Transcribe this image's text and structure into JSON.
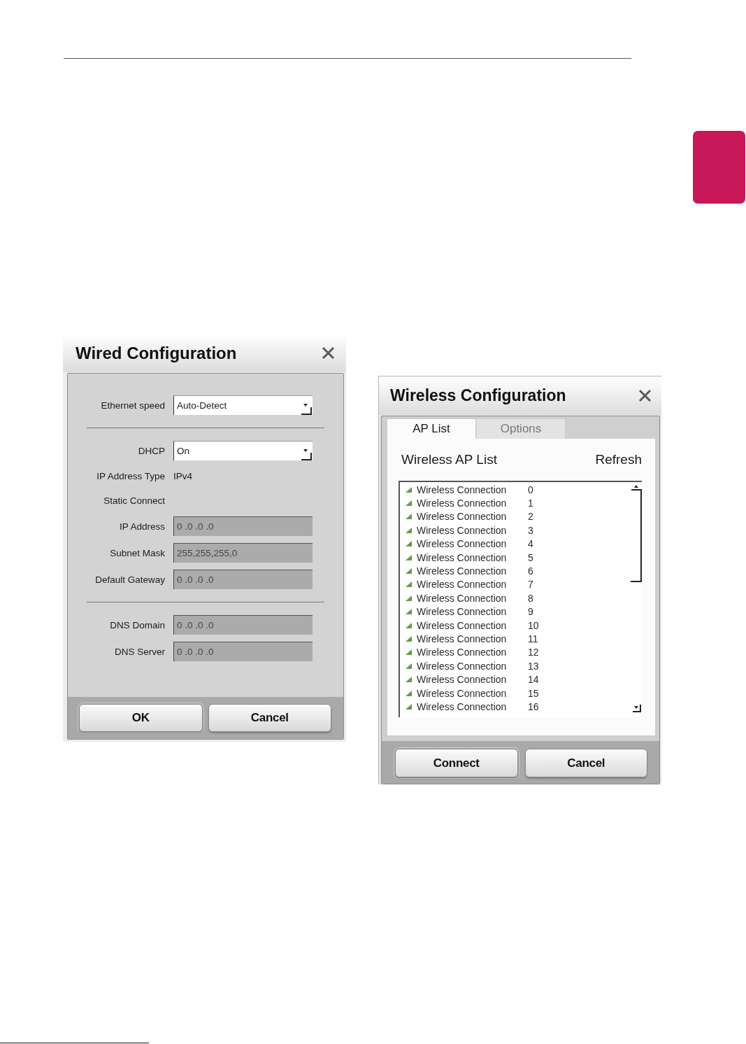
{
  "wired_dialog": {
    "title": "Wired Configuration",
    "sections": [
      {
        "rows": [
          {
            "kind": "dropdown",
            "label": "Ethernet speed",
            "value": "Auto-Detect"
          }
        ]
      },
      {
        "rows": [
          {
            "kind": "dropdown",
            "label": "DHCP",
            "value": "On"
          },
          {
            "kind": "text",
            "label": "IP Address Type",
            "value": "IPv4"
          },
          {
            "kind": "heading",
            "label": "Static Connect"
          },
          {
            "kind": "field",
            "label": "IP Address",
            "value": "0 .0 .0 .0",
            "disabled": true
          },
          {
            "kind": "field",
            "label": "Subnet Mask",
            "value": "255,255,255,0",
            "disabled": true
          },
          {
            "kind": "field",
            "label": "Default Gateway",
            "value": "0 .0 .0 .0",
            "disabled": true
          }
        ]
      },
      {
        "rows": [
          {
            "kind": "field",
            "label": "DNS Domain",
            "value": "0 .0 .0 .0",
            "disabled": true
          },
          {
            "kind": "field",
            "label": "DNS Server",
            "value": "0 .0 .0 .0",
            "disabled": true
          }
        ]
      }
    ],
    "buttons": [
      {
        "label": "OK",
        "focused": true
      },
      {
        "label": "Cancel",
        "focused": false
      }
    ]
  },
  "wireless_dialog": {
    "title": "Wireless Configuration",
    "tabs": [
      {
        "label": "AP List",
        "selected": true
      },
      {
        "label": "Options",
        "selected": false
      }
    ],
    "list_title": "Wireless AP List",
    "refresh": "Refresh",
    "access_points": [
      {
        "name": "Wireless Connection",
        "number": "0"
      },
      {
        "name": "Wireless Connection",
        "number": "1"
      },
      {
        "name": "Wireless Connection",
        "number": "2"
      },
      {
        "name": "Wireless Connection",
        "number": "3"
      },
      {
        "name": "Wireless Connection",
        "number": "4"
      },
      {
        "name": "Wireless Connection",
        "number": "5"
      },
      {
        "name": "Wireless Connection",
        "number": "6"
      },
      {
        "name": "Wireless Connection",
        "number": "7"
      },
      {
        "name": "Wireless Connection",
        "number": "8"
      },
      {
        "name": "Wireless Connection",
        "number": "9"
      },
      {
        "name": "Wireless Connection",
        "number": "10"
      },
      {
        "name": "Wireless Connection",
        "number": "11"
      },
      {
        "name": "Wireless Connection",
        "number": "12"
      },
      {
        "name": "Wireless Connection",
        "number": "13"
      },
      {
        "name": "Wireless Connection",
        "number": "14"
      },
      {
        "name": "Wireless Connection",
        "number": "15"
      },
      {
        "name": "Wireless Connection",
        "number": "16"
      }
    ],
    "buttons": [
      {
        "label": "Connect",
        "focused": true
      },
      {
        "label": "Cancel",
        "focused": false
      }
    ]
  }
}
